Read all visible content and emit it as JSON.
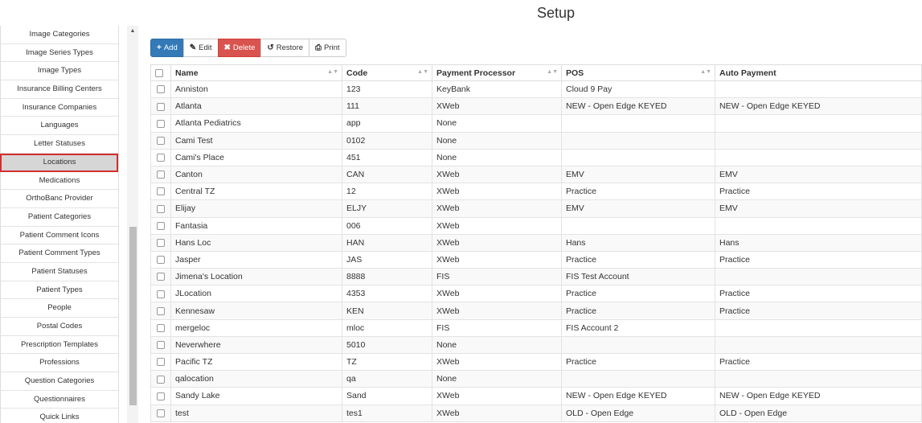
{
  "header": {
    "title": "Setup"
  },
  "sidebar": {
    "items": [
      {
        "label": "Image Categories"
      },
      {
        "label": "Image Series Types"
      },
      {
        "label": "Image Types"
      },
      {
        "label": "Insurance Billing Centers"
      },
      {
        "label": "Insurance Companies"
      },
      {
        "label": "Languages"
      },
      {
        "label": "Letter Statuses"
      },
      {
        "label": "Locations",
        "active": true
      },
      {
        "label": "Medications"
      },
      {
        "label": "OrthoBanc Provider"
      },
      {
        "label": "Patient Categories"
      },
      {
        "label": "Patient Comment Icons"
      },
      {
        "label": "Patient Comment Types"
      },
      {
        "label": "Patient Statuses"
      },
      {
        "label": "Patient Types"
      },
      {
        "label": "People"
      },
      {
        "label": "Postal Codes"
      },
      {
        "label": "Prescription Templates"
      },
      {
        "label": "Professions"
      },
      {
        "label": "Question Categories"
      },
      {
        "label": "Questionnaires"
      },
      {
        "label": "Quick Links"
      }
    ]
  },
  "toolbar": {
    "add_label": "Add",
    "edit_label": "Edit",
    "delete_label": "Delete",
    "restore_label": "Restore",
    "print_label": "Print"
  },
  "table": {
    "columns": [
      "Name",
      "Code",
      "Payment Processor",
      "POS",
      "Auto Payment"
    ],
    "rows": [
      [
        "Anniston",
        "123",
        "KeyBank",
        "Cloud 9 Pay",
        ""
      ],
      [
        "Atlanta",
        "111",
        "XWeb",
        "NEW - Open Edge KEYED",
        "NEW - Open Edge KEYED"
      ],
      [
        "Atlanta Pediatrics",
        "app",
        "None",
        "",
        ""
      ],
      [
        "Cami Test",
        "0102",
        "None",
        "",
        ""
      ],
      [
        "Cami's Place",
        "451",
        "None",
        "",
        ""
      ],
      [
        "Canton",
        "CAN",
        "XWeb",
        "EMV",
        "EMV"
      ],
      [
        "Central TZ",
        "12",
        "XWeb",
        "Practice",
        "Practice"
      ],
      [
        "Elijay",
        "ELJY",
        "XWeb",
        "EMV",
        "EMV"
      ],
      [
        "Fantasia",
        "006",
        "XWeb",
        "",
        ""
      ],
      [
        "Hans Loc",
        "HAN",
        "XWeb",
        "Hans",
        "Hans"
      ],
      [
        "Jasper",
        "JAS",
        "XWeb",
        "Practice",
        "Practice"
      ],
      [
        "Jimena's Location",
        "8888",
        "FIS",
        "FIS Test Account",
        ""
      ],
      [
        "JLocation",
        "4353",
        "XWeb",
        "Practice",
        "Practice"
      ],
      [
        "Kennesaw",
        "KEN",
        "XWeb",
        "Practice",
        "Practice"
      ],
      [
        "mergeloc",
        "mloc",
        "FIS",
        "FIS Account 2",
        ""
      ],
      [
        "Neverwhere",
        "5010",
        "None",
        "",
        ""
      ],
      [
        "Pacific TZ",
        "TZ",
        "XWeb",
        "Practice",
        "Practice"
      ],
      [
        "qalocation",
        "qa",
        "None",
        "",
        ""
      ],
      [
        "Sandy Lake",
        "Sand",
        "XWeb",
        "NEW - Open Edge KEYED",
        "NEW - Open Edge KEYED"
      ],
      [
        "test",
        "tes1",
        "XWeb",
        "OLD - Open Edge",
        "OLD - Open Edge"
      ]
    ]
  },
  "colors": {
    "primary": "#337ab7",
    "danger": "#d9534f",
    "highlight": "#d32f2f"
  }
}
